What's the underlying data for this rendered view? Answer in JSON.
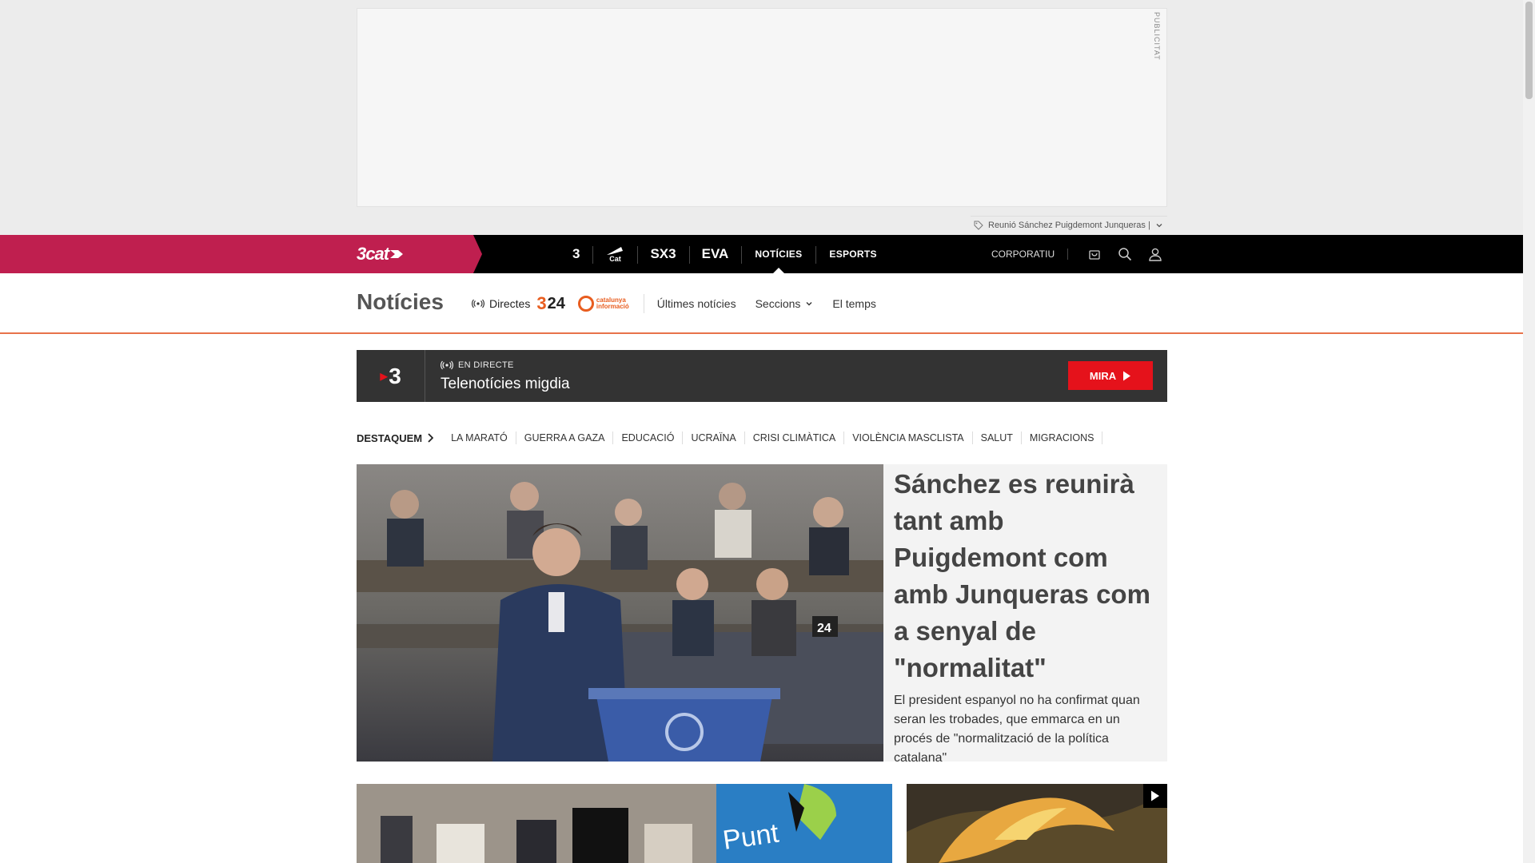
{
  "ad": {
    "label": "PUBLICITAT",
    "tag_text": "Reunió Sánchez Puigdemont Junqueras |"
  },
  "topnav": {
    "brand": "3cat",
    "channels": [
      "3",
      "Cat",
      "SX3",
      "EVA"
    ],
    "links": [
      "NOTÍCIES",
      "ESPORTS"
    ],
    "corporate": "CORPORATIU"
  },
  "secnav": {
    "title": "Notícies",
    "directes": "Directes",
    "logo_324": "24",
    "logo_cat_line1": "catalunya",
    "logo_cat_line2": "informació",
    "links": [
      "Últimes notícies",
      "Seccions",
      "El temps"
    ]
  },
  "live": {
    "channel": "3",
    "tag": "EN DIRECTE",
    "title": "Telenotícies migdia",
    "button": "MIRA"
  },
  "destaquem": {
    "label": "DESTAQUEM",
    "items": [
      "LA MARATÓ",
      "GUERRA A GAZA",
      "EDUCACIÓ",
      "UCRAÏNA",
      "CRISI CLIMÀTICA",
      "VIOLÈNCIA MASCLISTA",
      "SALUT",
      "MIGRACIONS"
    ]
  },
  "hero": {
    "title": "Sánchez es reunirà tant amb Puigdemont com amb Junqueras com a senyal de \"normalitat\"",
    "subtitle": "El president espanyol no ha confirmat quan seran les trobades, que emmarca en un procés de \"normalització de la política catalana\""
  },
  "cards": {
    "card1_text": "Punt"
  },
  "colors": {
    "brand": "#bf1f4f",
    "accent": "#e5121b",
    "orange": "#e8724a"
  }
}
